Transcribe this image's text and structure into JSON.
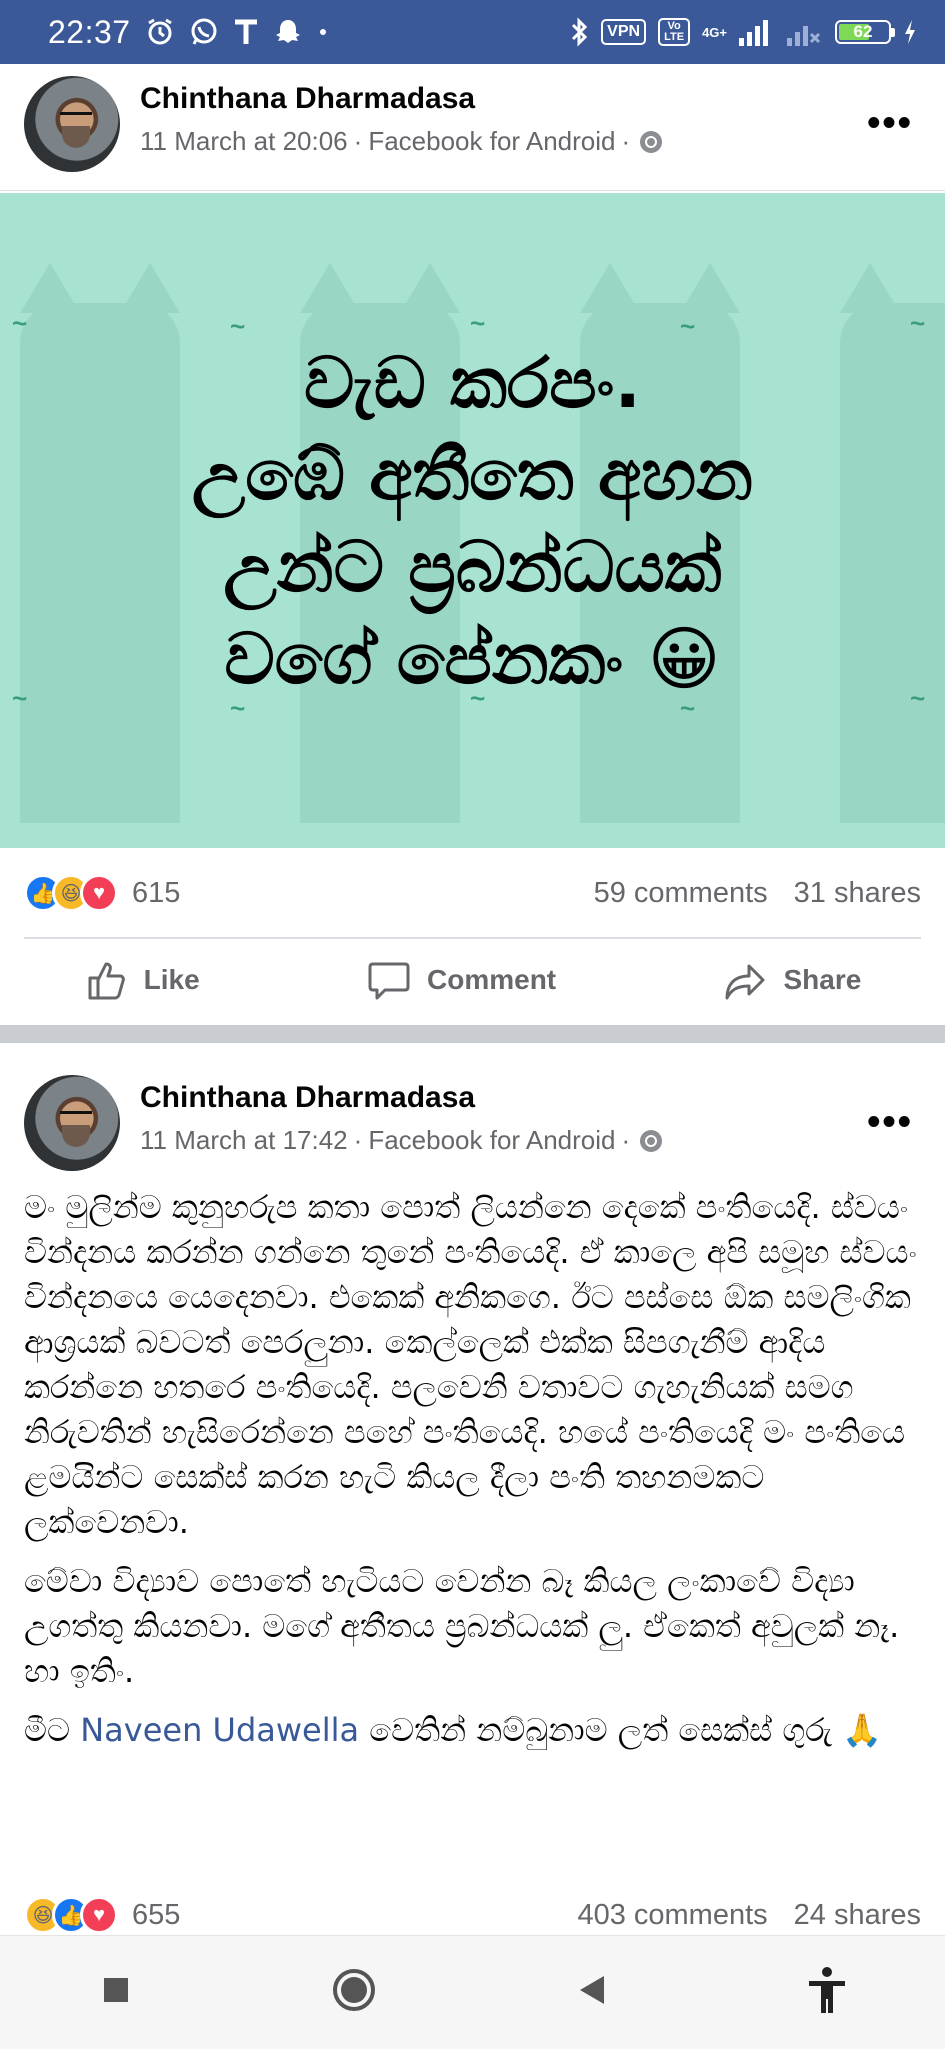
{
  "status_bar": {
    "time": "22:37",
    "icons": [
      "alarm-icon",
      "whatsapp-icon",
      "t-icon",
      "snapchat-icon",
      "dot-icon"
    ],
    "right_icons": [
      "bluetooth-icon",
      "vpn-badge",
      "volte-badge",
      "signal-icon",
      "signal-weak-icon",
      "battery-icon",
      "charging-icon"
    ],
    "vpn": "VPN",
    "volte": "Vo LTE",
    "network": "4G+",
    "battery": "62"
  },
  "post1": {
    "author": "Chinthana Dharmadasa",
    "timestamp": "11 March at 20:06",
    "source": "Facebook for Android",
    "image_lines": [
      "වැඩ කරපං.",
      "උඹේ අතීතෙ අහන",
      "උන්ට ප්‍රබන්ධයක්",
      "වගේ පේනකං 😀"
    ],
    "image_bg": "#a8e2d3",
    "reaction_count": "615",
    "comments": "59 comments",
    "shares": "31 shares"
  },
  "actions": {
    "like": "Like",
    "comment": "Comment",
    "share": "Share"
  },
  "post2": {
    "author": "Chinthana Dharmadasa",
    "timestamp": "11 March at 17:42",
    "source": "Facebook for Android",
    "paragraph1": "මං මුලින්ම කුනුහරුප කතා පොත් ලියන්නෙ දෙකේ පංතියෙදි. ස්වයං වින්දනය කරන්න ගන්නෙ තුනේ පංතියෙදි. ඒ කාලෙ අපි සමූහ ස්වයං වින්දනයෙ යෙදෙනවා. එකෙක් අනිකගෙ. ඊට පස්සෙ ඕක සමලිංගික ආශ්‍රයක් බවටත් පෙරලුනා. කෙල්ලෙක් එක්ක සිපගැනීම් ආදිය කරන්නෙ හතරෙ පංතියෙදි. පලවෙනි වතාවට ගැහැනියක් සමග නිරුවතින් හැසිරෙන්නෙ පහේ පංතියෙදි. හයේ පංතියෙදි මං පංතියෙ ළමයින්ට සෙක්ස් කරන හැටි කියල දීලා පංති තහනමකට ලක්වෙනවා.",
    "paragraph2": "මේවා විද්‍යාව පොතේ හැටියට වෙන්න බෑ කියල ලංකාවේ විද්‍යා උගත්තු කියනවා. මගේ අතීතය ප්‍රබන්ධයක් ලු. ඒකෙත් අවුලක් නෑ. හා ඉතිං.",
    "paragraph3_pre": "මීට ",
    "mention": "Naveen Udawella",
    "paragraph3_post": " වෙතින් නම්බුනාම ලත් සෙක්ස් ගුරු 🙏",
    "reaction_count": "655",
    "comments": "403 comments",
    "shares": "24 shares"
  },
  "nav": {
    "buttons": [
      "recents-button",
      "home-button",
      "back-button",
      "accessibility-button"
    ]
  }
}
